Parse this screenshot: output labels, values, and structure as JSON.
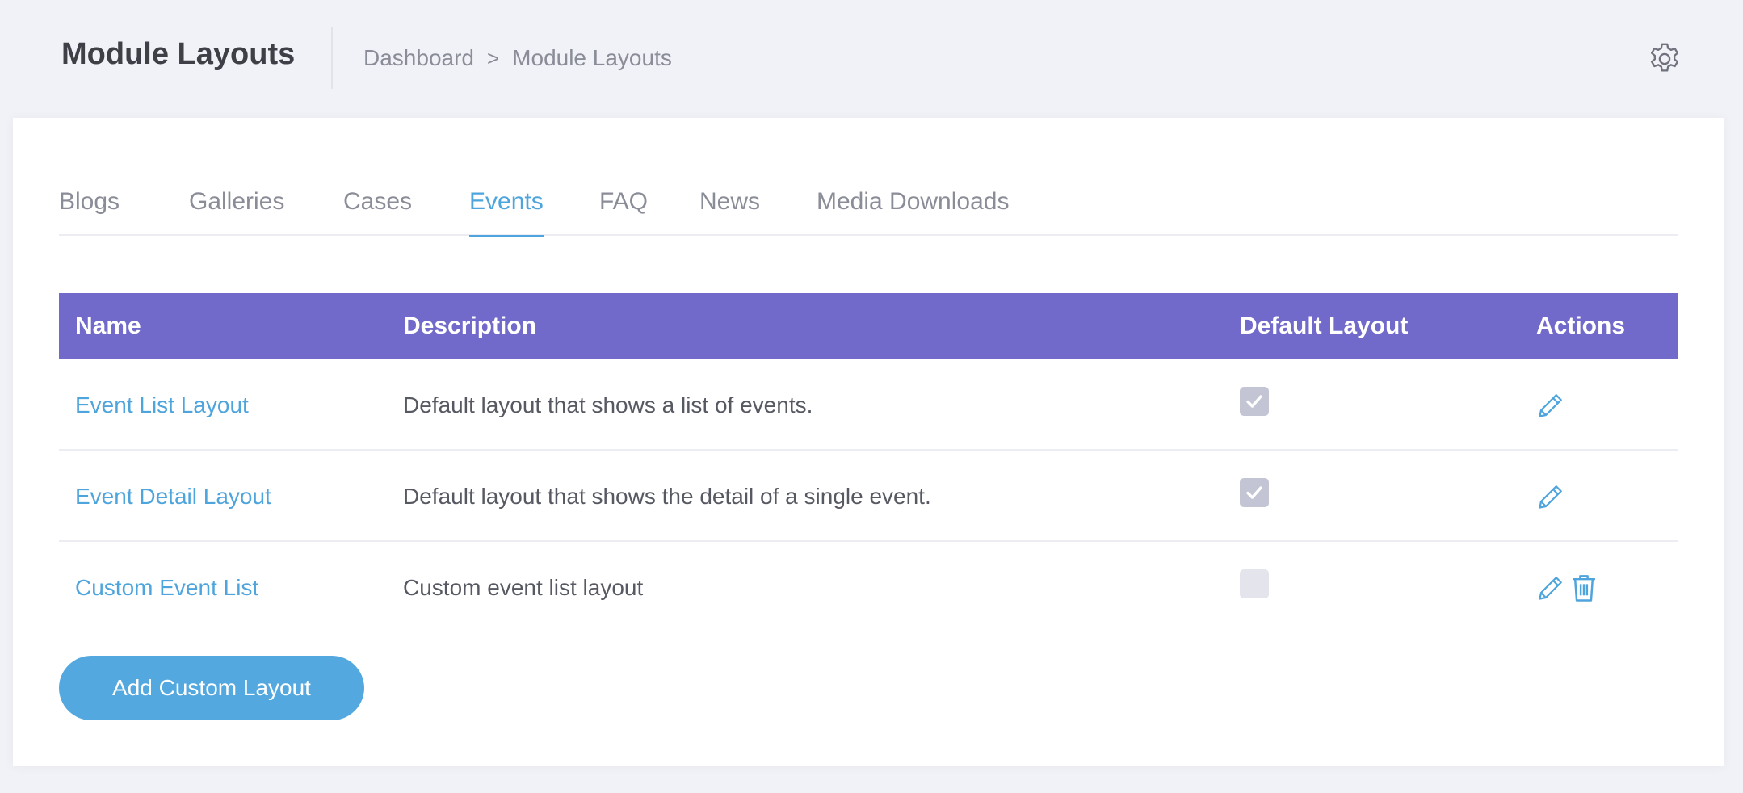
{
  "header": {
    "title": "Module Layouts",
    "breadcrumb": [
      {
        "label": "Dashboard"
      },
      {
        "label": "Module Layouts"
      }
    ],
    "breadcrumb_separator": ">",
    "settings_icon": "gear-icon"
  },
  "tabs": [
    {
      "label": "Blogs",
      "active": false
    },
    {
      "label": "Galleries",
      "active": false
    },
    {
      "label": "Cases",
      "active": false
    },
    {
      "label": "Events",
      "active": true
    },
    {
      "label": "FAQ",
      "active": false
    },
    {
      "label": "News",
      "active": false
    },
    {
      "label": "Media Downloads",
      "active": false
    }
  ],
  "table": {
    "columns": [
      "Name",
      "Description",
      "Default Layout",
      "Actions"
    ],
    "rows": [
      {
        "name": "Event List Layout",
        "description": "Default layout that shows a list of events.",
        "default": true,
        "actions": [
          "edit"
        ]
      },
      {
        "name": "Event Detail Layout",
        "description": "Default layout that shows the detail of a single event.",
        "default": true,
        "actions": [
          "edit"
        ]
      },
      {
        "name": "Custom Event List",
        "description": "Custom event list layout",
        "default": false,
        "actions": [
          "edit",
          "delete"
        ]
      }
    ]
  },
  "add_button": {
    "label": "Add Custom Layout"
  },
  "colors": {
    "accent": "#4ea4dc",
    "table_header": "#716aca",
    "button": "#53a8df",
    "page_bg": "#f1f2f7"
  }
}
